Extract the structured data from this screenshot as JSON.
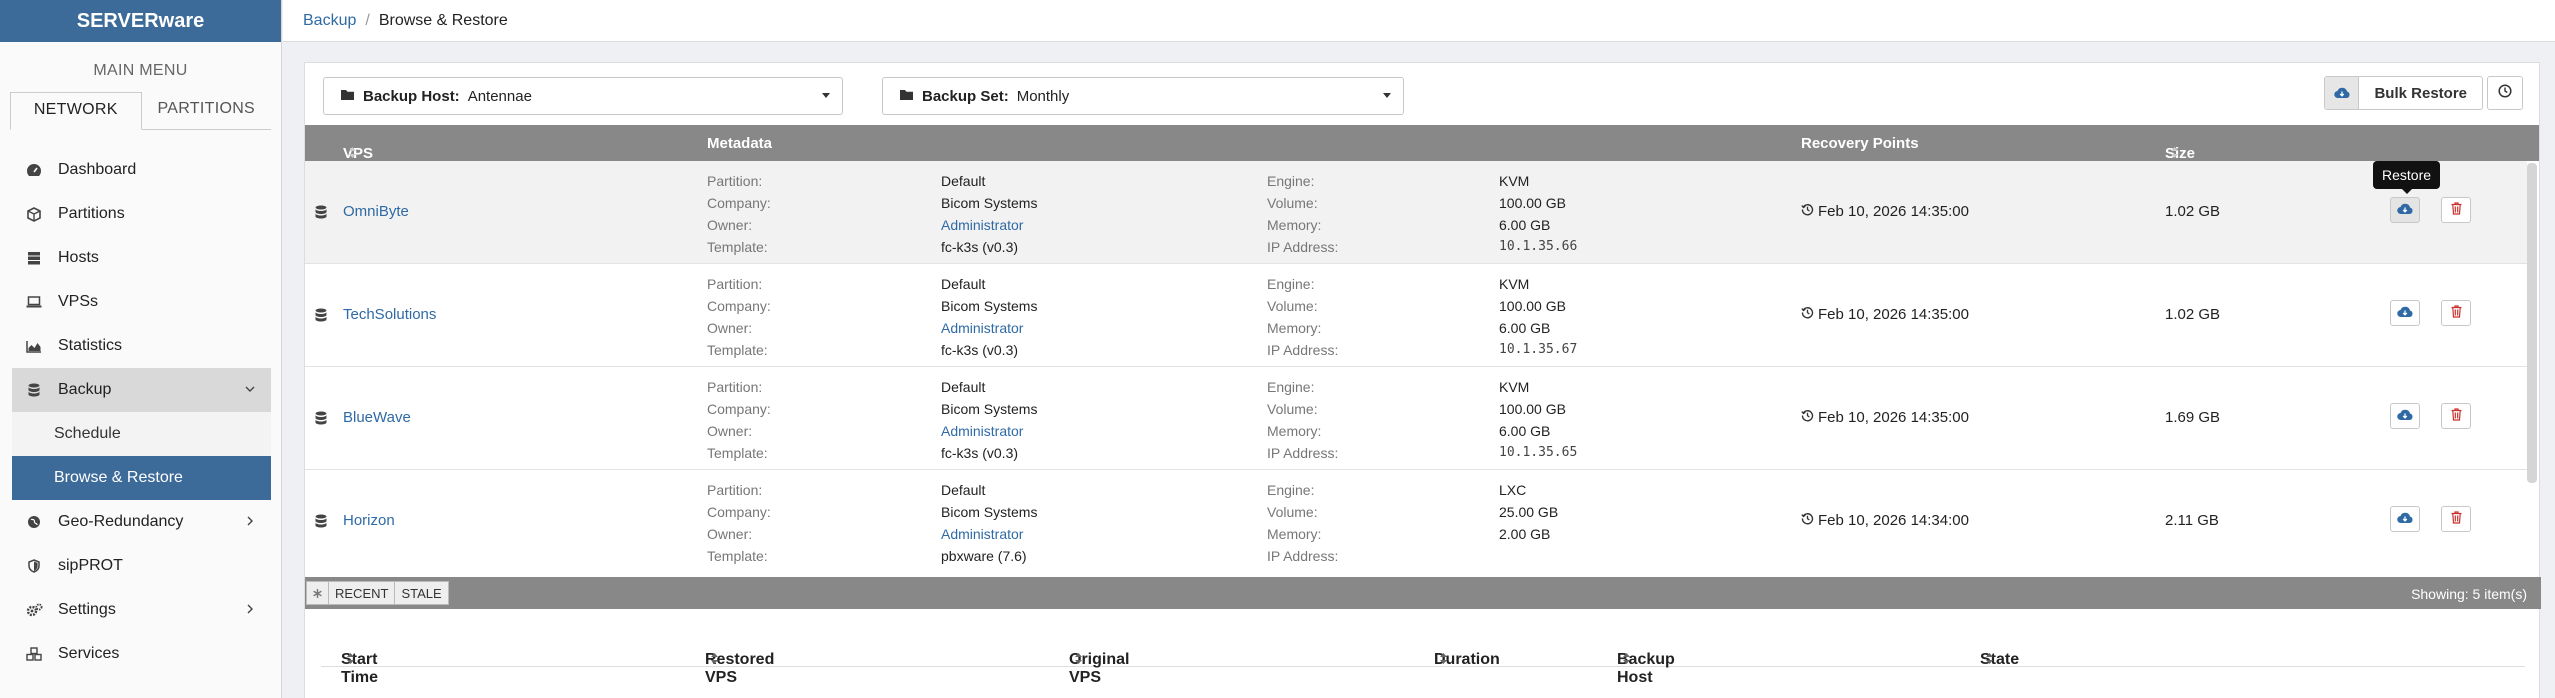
{
  "brand": "SERVERware",
  "menu": {
    "title": "MAIN MENU",
    "tabs": [
      "NETWORK",
      "PARTITIONS"
    ],
    "items": [
      {
        "label": "Dashboard",
        "icon": "dashboard-icon"
      },
      {
        "label": "Partitions",
        "icon": "cube-icon"
      },
      {
        "label": "Hosts",
        "icon": "server-icon"
      },
      {
        "label": "VPSs",
        "icon": "laptop-icon"
      },
      {
        "label": "Statistics",
        "icon": "area-chart-icon"
      },
      {
        "label": "Backup",
        "icon": "database-icon"
      },
      {
        "label": "Geo-Redundancy",
        "icon": "globe-icon"
      },
      {
        "label": "sipPROT",
        "icon": "shield-icon"
      },
      {
        "label": "Settings",
        "icon": "gears-icon"
      },
      {
        "label": "Services",
        "icon": "cubes-icon"
      }
    ],
    "backup_sub": [
      "Schedule",
      "Browse & Restore"
    ]
  },
  "breadcrumb": {
    "parent": "Backup",
    "current": "Browse & Restore"
  },
  "toolbar": {
    "host_label": "Backup Host:",
    "host_value": "Antennae",
    "set_label": "Backup Set:",
    "set_value": "Monthly",
    "bulk_restore": "Bulk Restore"
  },
  "grid": {
    "columns": {
      "vps": "VPS",
      "metadata": "Metadata",
      "recovery": "Recovery Points",
      "size": "Size"
    },
    "meta_keys": {
      "partition": "Partition:",
      "company": "Company:",
      "owner": "Owner:",
      "template": "Template:",
      "engine": "Engine:",
      "volume": "Volume:",
      "memory": "Memory:",
      "ip": "IP Address:"
    },
    "rows": [
      {
        "name": "OmniByte",
        "partition": "Default",
        "company": "Bicom Systems",
        "owner": "Administrator",
        "template": "fc-k3s (v0.3)",
        "engine": "KVM",
        "volume": "100.00 GB",
        "memory": "6.00 GB",
        "ip": "10.1.35.66",
        "recovery": "Feb 10, 2026 14:35:00",
        "size": "1.02 GB"
      },
      {
        "name": "TechSolutions",
        "partition": "Default",
        "company": "Bicom Systems",
        "owner": "Administrator",
        "template": "fc-k3s (v0.3)",
        "engine": "KVM",
        "volume": "100.00 GB",
        "memory": "6.00 GB",
        "ip": "10.1.35.67",
        "recovery": "Feb 10, 2026 14:35:00",
        "size": "1.02 GB"
      },
      {
        "name": "BlueWave",
        "partition": "Default",
        "company": "Bicom Systems",
        "owner": "Administrator",
        "template": "fc-k3s (v0.3)",
        "engine": "KVM",
        "volume": "100.00 GB",
        "memory": "6.00 GB",
        "ip": "10.1.35.65",
        "recovery": "Feb 10, 2026 14:35:00",
        "size": "1.69 GB"
      },
      {
        "name": "Horizon",
        "partition": "Default",
        "company": "Bicom Systems",
        "owner": "Administrator",
        "template": "pbxware (7.6)",
        "engine": "LXC",
        "volume": "25.00 GB",
        "memory": "2.00 GB",
        "ip": "",
        "recovery": "Feb 10, 2026 14:34:00",
        "size": "2.11 GB"
      }
    ],
    "tooltip": "Restore",
    "filters": [
      "RECENT",
      "STALE"
    ],
    "showing": "Showing: 5 item(s)"
  },
  "history": {
    "columns": [
      "Start Time",
      "Restored VPS",
      "Original VPS",
      "Duration",
      "Backup Host",
      "State"
    ]
  },
  "colors": {
    "brand": "#3c6a99",
    "link": "#2f6aa5",
    "header": "#888888",
    "danger": "#c9302c"
  }
}
